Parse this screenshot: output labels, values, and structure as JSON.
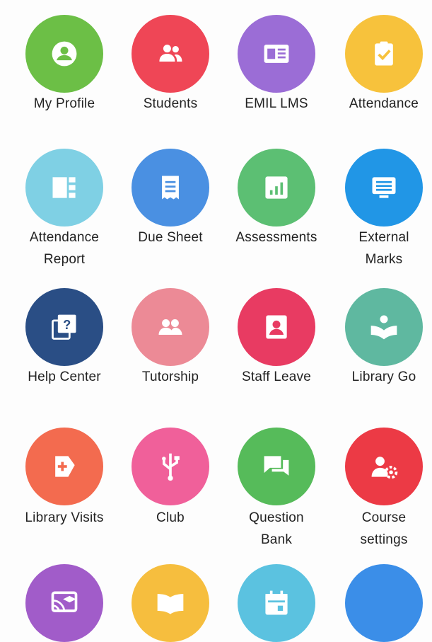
{
  "tiles": [
    {
      "label_lines": [
        "My Profile"
      ],
      "icon": "user-avatar-icon",
      "color": "#6cbf46"
    },
    {
      "label_lines": [
        "Students"
      ],
      "icon": "users-icon",
      "color": "#ef4656"
    },
    {
      "label_lines": [
        "EMIL LMS"
      ],
      "icon": "id-card-icon",
      "color": "#9b6dd6"
    },
    {
      "label_lines": [
        "Attendance"
      ],
      "icon": "clipboard-check-icon",
      "color": "#f7c23c"
    },
    {
      "label_lines": [
        "Attendance",
        "Report"
      ],
      "icon": "report-grid-icon",
      "color": "#7fd0e4"
    },
    {
      "label_lines": [
        "Due Sheet"
      ],
      "icon": "receipt-icon",
      "color": "#4a90e2"
    },
    {
      "label_lines": [
        "Assessments"
      ],
      "icon": "bar-chart-icon",
      "color": "#5cbf73"
    },
    {
      "label_lines": [
        "External",
        "Marks"
      ],
      "icon": "list-screen-icon",
      "color": "#2196e6"
    },
    {
      "label_lines": [
        "Help Center"
      ],
      "icon": "help-question-icon",
      "color": "#2a4e85"
    },
    {
      "label_lines": [
        "Tutorship"
      ],
      "icon": "group-icon",
      "color": "#ec8a96"
    },
    {
      "label_lines": [
        "Staff Leave"
      ],
      "icon": "staff-portrait-icon",
      "color": "#e83b62"
    },
    {
      "label_lines": [
        "Library Go"
      ],
      "icon": "book-reader-icon",
      "color": "#5fb8a0"
    },
    {
      "label_lines": [
        "Library Visits"
      ],
      "icon": "visit-add-icon",
      "color": "#f36b4f"
    },
    {
      "label_lines": [
        "Club"
      ],
      "icon": "usb-icon",
      "color": "#f0609a"
    },
    {
      "label_lines": [
        "Question",
        "Bank"
      ],
      "icon": "chat-bubbles-icon",
      "color": "#56bb5a"
    },
    {
      "label_lines": [
        "Course",
        "settings"
      ],
      "icon": "user-gear-icon",
      "color": "#ec3a45"
    },
    {
      "label_lines": [],
      "icon": "cast-education-icon",
      "color": "#a15cc9"
    },
    {
      "label_lines": [],
      "icon": "open-book-icon",
      "color": "#f6be3e"
    },
    {
      "label_lines": [],
      "icon": "calendar-icon",
      "color": "#5bc2e0"
    },
    {
      "label_lines": [],
      "icon": "blank-icon",
      "color": "#3b8ee8"
    }
  ]
}
